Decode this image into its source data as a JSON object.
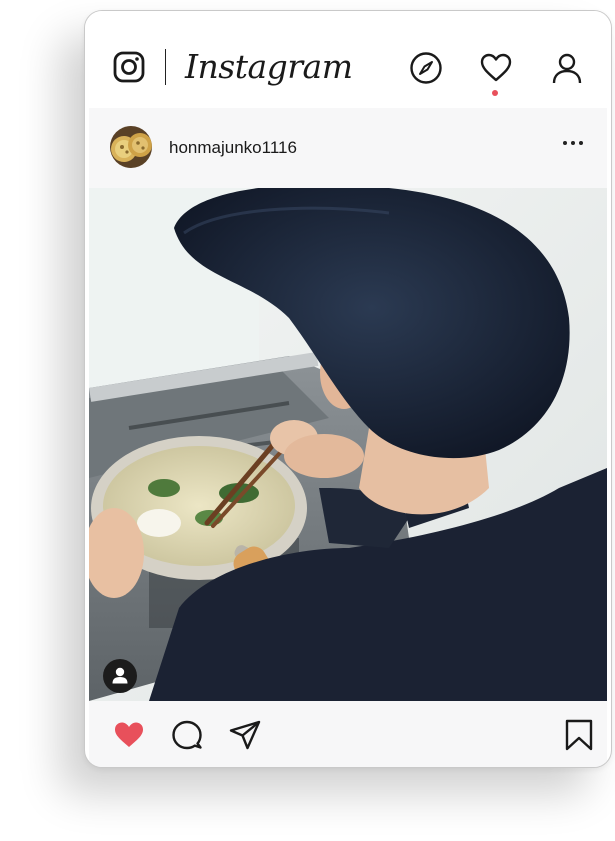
{
  "app": {
    "name": "Instagram"
  },
  "header": {
    "icons": [
      "instagram-glyph-icon",
      "compass-icon",
      "heart-icon",
      "user-icon"
    ],
    "notification_color": "#e8505b"
  },
  "post": {
    "username": "honmajunko1116",
    "photo_subject": "boy-cooking-at-stove",
    "liked": true,
    "like_color": "#e8505b"
  },
  "actions": {
    "icons": [
      "heart-filled-icon",
      "comment-icon",
      "share-icon",
      "bookmark-icon"
    ]
  }
}
